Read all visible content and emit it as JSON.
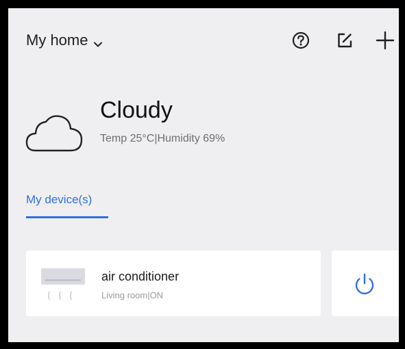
{
  "header": {
    "home_label": "My home",
    "icons": [
      "chevron-down-icon",
      "help-icon",
      "edit-icon",
      "plus-icon"
    ]
  },
  "weather": {
    "condition": "Cloudy",
    "details": "Temp 25°C|Humidity 69%",
    "icon": "cloud-icon"
  },
  "tabs": [
    {
      "label": "My device(s)",
      "active": true
    }
  ],
  "devices": [
    {
      "name": "air conditioner",
      "status": "Living room|ON",
      "icon": "air-conditioner-icon",
      "power_icon": "power-icon"
    }
  ],
  "colors": {
    "accent": "#2f6fe0",
    "background": "#efeff1",
    "card": "#ffffff"
  }
}
